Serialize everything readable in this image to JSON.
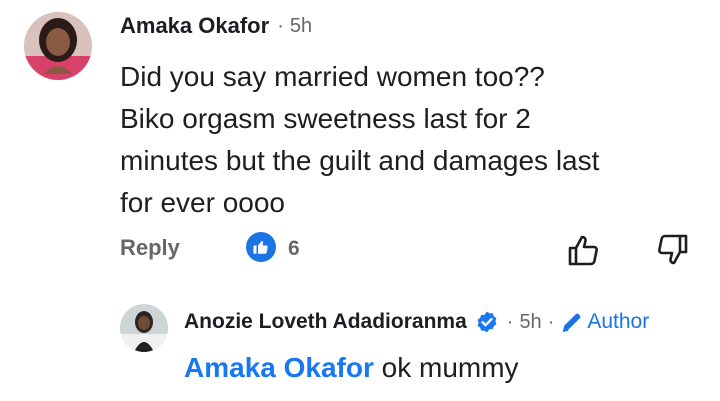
{
  "comment": {
    "author": "Amaka Okafor",
    "separator": "·",
    "time": "5h",
    "lines": [
      "Did you say married women too??",
      "Biko orgasm sweetness last for 2",
      "minutes but the guilt and damages last",
      "for ever oooo"
    ],
    "reply_label": "Reply",
    "like_count": "6"
  },
  "reply": {
    "author": "Anozie Loveth Adadioranma",
    "separator": "·",
    "time": "5h",
    "separator2": "·",
    "badge_label": "Author",
    "mention": "Amaka Okafor",
    "text": "ok mummy"
  },
  "colors": {
    "accent": "#1877f2",
    "like_badge": "#1b74e4",
    "meta": "#65676b"
  },
  "icons": [
    "like-icon",
    "thumbs-up-icon",
    "thumbs-down-icon",
    "verified-icon",
    "pencil-icon"
  ]
}
